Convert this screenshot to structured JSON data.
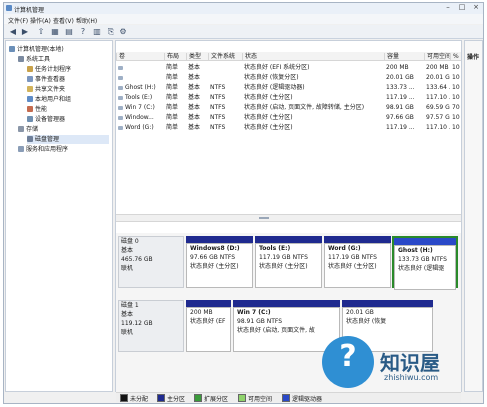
{
  "window": {
    "title": "计算机管理"
  },
  "menu": [
    "文件(F)",
    "操作(A)",
    "查看(V)",
    "帮助(H)"
  ],
  "tree": [
    {
      "label": "计算机管理(本地)",
      "indent": 0,
      "icon_color": "#6b8fb8"
    },
    {
      "label": "系统工具",
      "indent": 1,
      "icon_color": "#7b8aa0"
    },
    {
      "label": "任务计划程序",
      "indent": 2,
      "icon_color": "#c9a24a"
    },
    {
      "label": "事件查看器",
      "indent": 2,
      "icon_color": "#7a96c0"
    },
    {
      "label": "共享文件夹",
      "indent": 2,
      "icon_color": "#d2b35b"
    },
    {
      "label": "本地用户和组",
      "indent": 2,
      "icon_color": "#5f8cc7"
    },
    {
      "label": "性能",
      "indent": 2,
      "icon_color": "#c56b4e"
    },
    {
      "label": "设备管理器",
      "indent": 2,
      "icon_color": "#6f8fb0"
    },
    {
      "label": "存储",
      "indent": 1,
      "icon_color": "#8a96a8"
    },
    {
      "label": "磁盘管理",
      "indent": 2,
      "icon_color": "#6e7f99",
      "selected": true
    },
    {
      "label": "服务和应用程序",
      "indent": 1,
      "icon_color": "#8a9db7"
    }
  ],
  "columns": [
    "卷",
    "布局",
    "类型",
    "文件系统",
    "状态",
    "容量",
    "可用空间",
    "%"
  ],
  "volumes": [
    [
      "",
      "简单",
      "基本",
      "",
      "状态良好 (EFI 系统分区)",
      "200 MB",
      "200 MB",
      "10"
    ],
    [
      "",
      "简单",
      "基本",
      "",
      "状态良好 (恢复分区)",
      "20.01 GB",
      "20.01 GB",
      "10"
    ],
    [
      "Ghost (H:)",
      "简单",
      "基本",
      "NTFS",
      "状态良好 (逻辑驱动器)",
      "133.73 ...",
      "133.64 ...",
      "10"
    ],
    [
      "Tools (E:)",
      "简单",
      "基本",
      "NTFS",
      "状态良好 (主分区)",
      "117.19 ...",
      "117.10 ...",
      "10"
    ],
    [
      "Win 7 (C:)",
      "简单",
      "基本",
      "NTFS",
      "状态良好 (启动, 页面文件, 故障转储, 主分区)",
      "98.91 GB",
      "69.59 GB",
      "70"
    ],
    [
      "Window...",
      "简单",
      "基本",
      "NTFS",
      "状态良好 (主分区)",
      "97.66 GB",
      "97.57 GB",
      "10"
    ],
    [
      "Word (G:)",
      "简单",
      "基本",
      "NTFS",
      "状态良好 (主分区)",
      "117.19 ...",
      "117.10 ...",
      "10"
    ]
  ],
  "actions": {
    "title": "操作"
  },
  "disks": [
    {
      "name": "磁盘 0",
      "type": "基本",
      "size": "465.76 GB",
      "status": "联机",
      "partitions": [
        {
          "title": "Windows8 (D:)",
          "size": "97.66 GB NTFS",
          "status": "状态良好 (主分区)",
          "logical": false
        },
        {
          "title": "Tools (E:)",
          "size": "117.19 GB NTFS",
          "status": "状态良好 (主分区)",
          "logical": false
        },
        {
          "title": "Word (G:)",
          "size": "117.19 GB NTFS",
          "status": "状态良好 (主分区)",
          "logical": false
        },
        {
          "title": "Ghost (H:)",
          "size": "133.73 GB NTFS",
          "status": "状态良好 (逻辑驱",
          "logical": true
        }
      ]
    },
    {
      "name": "磁盘 1",
      "type": "基本",
      "size": "119.12 GB",
      "status": "联机",
      "partitions": [
        {
          "title": "",
          "size": "200 MB",
          "status": "状态良好 (EF",
          "logical": false
        },
        {
          "title": "Win 7 (C:)",
          "size": "98.91 GB NTFS",
          "status": "状态良好 (启动, 页面文件, 故",
          "logical": false
        },
        {
          "title": "",
          "size": "20.01 GB",
          "status": "状态良好 (恢复",
          "logical": false
        }
      ]
    }
  ],
  "legend": [
    {
      "label": "未分配",
      "color": "#111111"
    },
    {
      "label": "主分区",
      "color": "#1f2a8f"
    },
    {
      "label": "扩展分区",
      "color": "#3a9a3a"
    },
    {
      "label": "可用空间",
      "color": "#8fd36b"
    },
    {
      "label": "逻辑驱动器",
      "color": "#2a49c8"
    }
  ],
  "watermark": {
    "glyph": "?",
    "text": "知识屋",
    "url": "zhishiwu.com"
  }
}
